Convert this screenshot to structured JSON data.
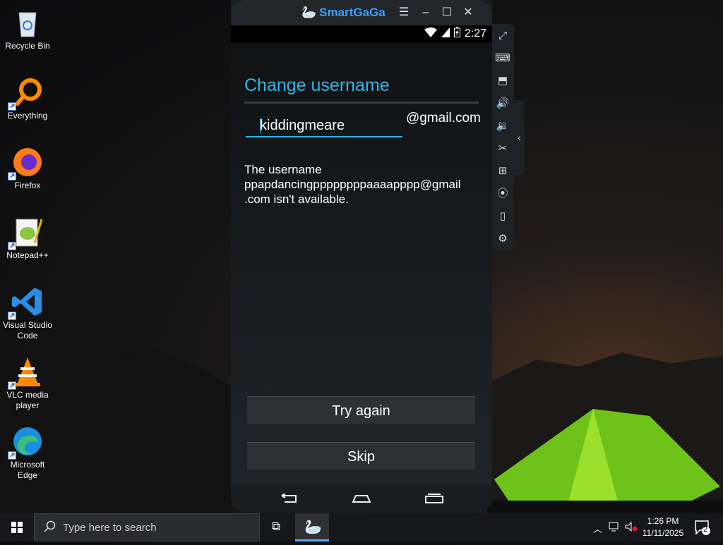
{
  "desktop": {
    "icons": [
      {
        "label": "Recycle Bin",
        "icon": "recycle-bin-icon"
      },
      {
        "label": "Everything",
        "icon": "everything-icon"
      },
      {
        "label": "Firefox",
        "icon": "firefox-icon"
      },
      {
        "label": "Notepad++",
        "icon": "notepad-plus-plus-icon"
      },
      {
        "label": "Visual Studio Code",
        "icon": "vscode-icon"
      },
      {
        "label": "VLC media player",
        "icon": "vlc-icon"
      },
      {
        "label": "Microsoft Edge",
        "icon": "edge-icon"
      }
    ]
  },
  "emulator": {
    "app_name": "SmartGaGa",
    "status_time": "2:27",
    "screen": {
      "title": "Change username",
      "username_value": "kiddingmeare",
      "domain_suffix": "@gmail.com",
      "message_line1": "The username",
      "message_line2": "ppapdancingppppppppaaaapppp@gmail",
      "message_line3": ".com isn't available.",
      "try_again": "Try again",
      "skip": "Skip"
    },
    "toolbar": [
      "fullscreen-icon",
      "keyboard-icon",
      "apk-install-icon",
      "volume-up-icon",
      "volume-down-icon",
      "screenshot-scissors-icon",
      "multi-instance-icon",
      "location-icon",
      "shake-icon",
      "settings-icon"
    ]
  },
  "taskbar": {
    "search_placeholder": "Type here to search",
    "time": "1:26 PM",
    "date": "11/11/2025",
    "notification_count": "2"
  },
  "colors": {
    "accent": "#33b5e5",
    "brand": "#3aa0ff"
  }
}
